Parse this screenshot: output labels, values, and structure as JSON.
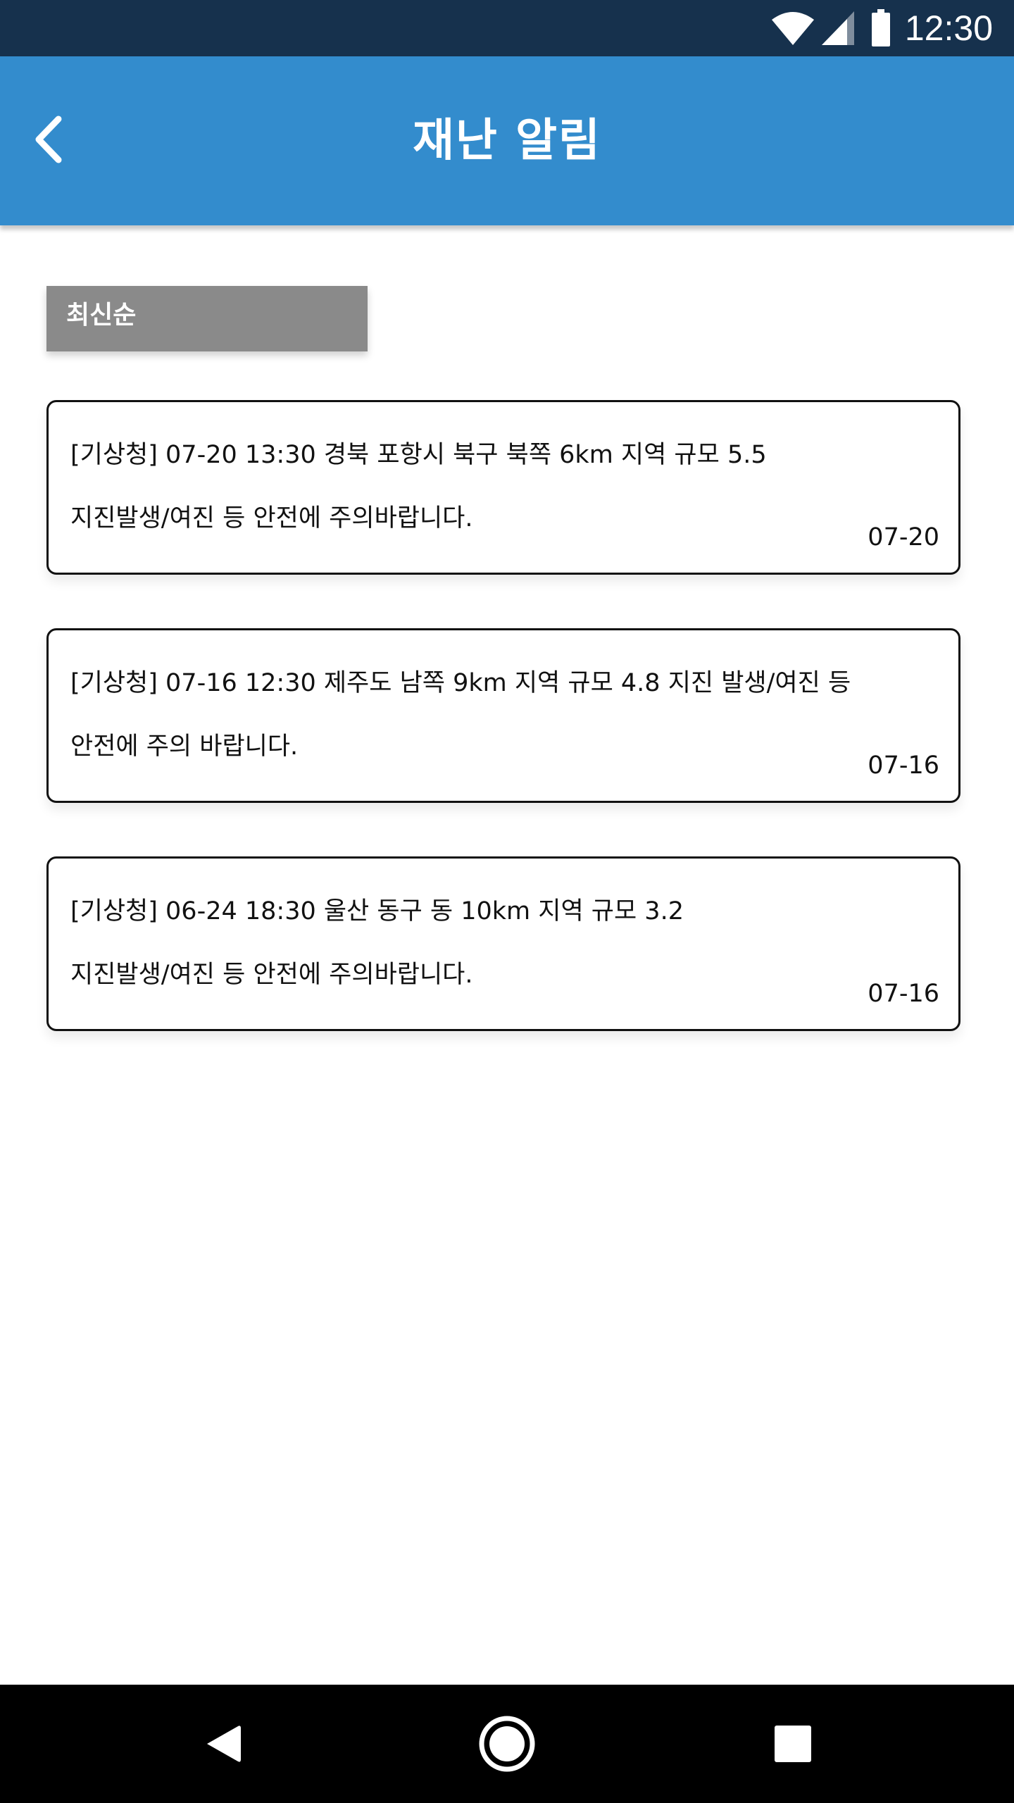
{
  "status_bar": {
    "time": "12:30",
    "icons": [
      "wifi-icon",
      "cell-signal-icon",
      "battery-icon"
    ]
  },
  "app_bar": {
    "back_icon": "chevron-left-icon",
    "title": "재난 알림"
  },
  "sort": {
    "label": "최신순"
  },
  "alerts": [
    {
      "line1": "[기상청] 07-20 13:30 경북 포항시 북구 북쪽  6km 지역 규모 5.5",
      "line2": "지진발생/여진 등 안전에 주의바랍니다.",
      "date": "07-20"
    },
    {
      "line1": "[기상청] 07-16 12:30  제주도 남쪽 9km 지역 규모 4.8 지진 발생/여진 등",
      "line2": "안전에 주의 바랍니다.",
      "date": "07-16"
    },
    {
      "line1": "[기상청] 06-24 18:30   울산 동구 동 10km 지역 규모 3.2",
      "line2": "지진발생/여진 등 안전에 주의바랍니다.",
      "date": "07-16"
    }
  ],
  "nav_bar": {
    "icons": [
      "nav-back-icon",
      "nav-home-icon",
      "nav-recents-icon"
    ]
  },
  "colors": {
    "status_bar": "#16314d",
    "app_bar": "#338ccd",
    "sort_button": "#8a8a8a",
    "nav_bar": "#000000"
  }
}
